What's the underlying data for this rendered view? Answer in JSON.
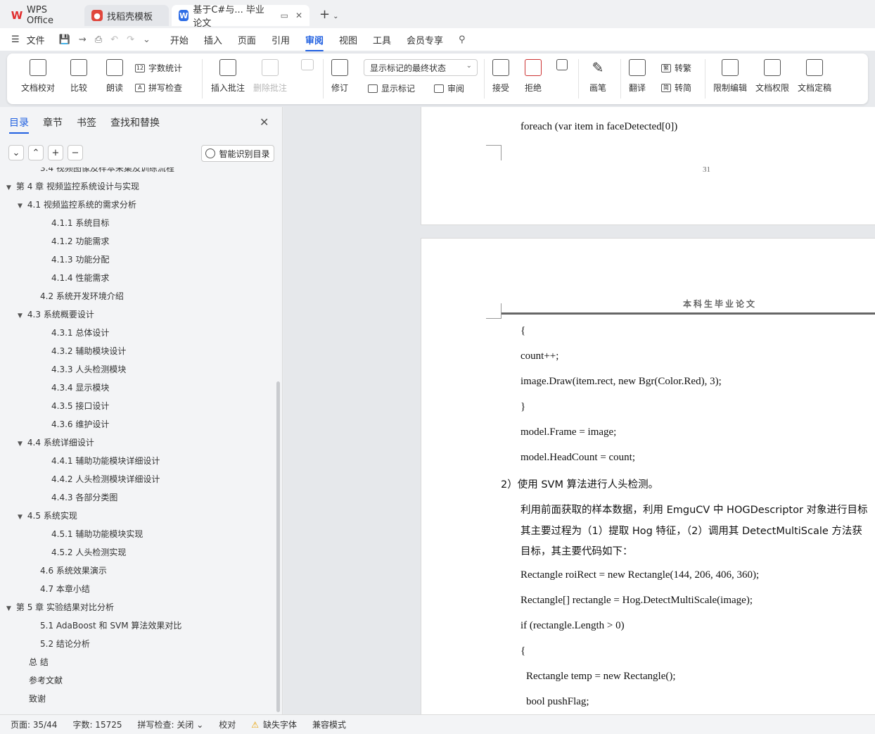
{
  "tabs": {
    "wps": "WPS Office",
    "template": "找稻壳模板",
    "document": "基于C#与... 毕业论文"
  },
  "menu": {
    "file": "文件",
    "items": [
      "开始",
      "插入",
      "页面",
      "引用",
      "审阅",
      "视图",
      "工具",
      "会员专享"
    ],
    "active": "审阅"
  },
  "ribbon": {
    "doc_check": "文档校对",
    "compare": "比较",
    "read_aloud": "朗读",
    "word_count": "字数统计",
    "spell_check": "拼写检查",
    "insert_comment": "插入批注",
    "delete_comment": "删除批注",
    "revise": "修订",
    "markup_state": "显示标记的最终状态",
    "show_markup": "显示标记",
    "review": "审阅",
    "accept": "接受",
    "reject": "拒绝",
    "ink": "画笔",
    "translate": "翻译",
    "to_traditional": "转繁",
    "to_simplified": "转简",
    "restrict_edit": "限制编辑",
    "doc_permission": "文档权限",
    "finalize": "文档定稿"
  },
  "nav": {
    "tabs": [
      "目录",
      "章节",
      "书签",
      "查找和替换"
    ],
    "smart_toc": "智能识别目录",
    "toc": [
      {
        "text": "3.4  视频图像及样本采集及训练流程",
        "level": 2
      },
      {
        "text": "第 4 章   视频监控系统设计与实现",
        "level": 1,
        "arrow": true
      },
      {
        "text": "4.1   视频监控系统的需求分析",
        "level": 2,
        "arrow": true
      },
      {
        "text": "4.1.1  系统目标",
        "level": 3
      },
      {
        "text": "4.1.2  功能需求",
        "level": 3
      },
      {
        "text": "4.1.3  功能分配",
        "level": 3
      },
      {
        "text": "4.1.4  性能需求",
        "level": 3
      },
      {
        "text": "4.2  系统开发环境介绍",
        "level": 2
      },
      {
        "text": "4.3 系统概要设计",
        "level": 2,
        "arrow": true
      },
      {
        "text": "4.3.1  总体设计",
        "level": 3
      },
      {
        "text": "4.3.2  辅助模块设计",
        "level": 3
      },
      {
        "text": "4.3.3  人头检测模块",
        "level": 3
      },
      {
        "text": "4.3.4  显示模块",
        "level": 3
      },
      {
        "text": "4.3.5  接口设计",
        "level": 3
      },
      {
        "text": "4.3.6 维护设计",
        "level": 3
      },
      {
        "text": "4.4  系统详细设计",
        "level": 2,
        "arrow": true
      },
      {
        "text": "4.4.1  辅助功能模块详细设计",
        "level": 3
      },
      {
        "text": "4.4.2  人头检测模块详细设计",
        "level": 3
      },
      {
        "text": "4.4.3  各部分类图",
        "level": 3
      },
      {
        "text": "4.5  系统实现",
        "level": 2,
        "arrow": true
      },
      {
        "text": "4.5.1  辅助功能模块实现",
        "level": 3
      },
      {
        "text": "4.5.2 人头检测实现",
        "level": 3
      },
      {
        "text": "4.6  系统效果演示",
        "level": 2
      },
      {
        "text": "4.7 本章小结",
        "level": 2
      },
      {
        "text": "第 5 章   实验结果对比分析",
        "level": 1,
        "arrow": true
      },
      {
        "text": "5.1 AdaBoost 和 SVM 算法效果对比",
        "level": 2
      },
      {
        "text": "5.2 结论分析",
        "level": 2
      },
      {
        "text": "总  结",
        "level": 1
      },
      {
        "text": "参考文献",
        "level": 1
      },
      {
        "text": "致谢",
        "level": 1
      }
    ]
  },
  "document": {
    "page1_lines": [
      "foreach (var item in faceDetected[0])"
    ],
    "page1_number": "31",
    "header": "本科生毕业论文",
    "page2_lines": [
      "{",
      "count++;",
      "image.Draw(item.rect, new Bgr(Color.Red), 3);",
      "}",
      "model.Frame = image;",
      "model.HeadCount = count;",
      "2）使用 SVM 算法进行人头检测。",
      "利用前面获取的样本数据，利用 EmguCV 中 HOGDescriptor 对象进行目标",
      "其主要过程为（1）提取 Hog 特征，（2）调用其 DetectMultiScale 方法获",
      "目标，其主要代码如下：",
      "Rectangle roiRect = new Rectangle(144, 206, 406, 360);",
      "Rectangle[] rectangle = Hog.DetectMultiScale(image);",
      "if (rectangle.Length > 0)",
      "{",
      "  Rectangle temp = new Rectangle();",
      "  bool pushFlag;"
    ]
  },
  "status": {
    "page": "页面: 35/44",
    "words": "字数: 15725",
    "spell": "拼写检查: 关闭",
    "proof": "校对",
    "missing_font": "缺失字体",
    "compat": "兼容模式"
  }
}
